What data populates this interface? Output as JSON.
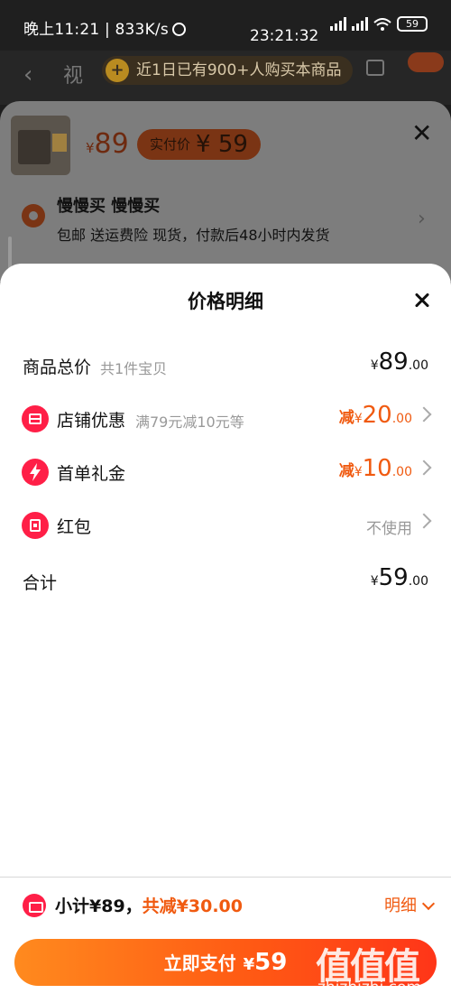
{
  "status_bar": {
    "left_text": "晚上11:21 | 833K/s",
    "time_center": "23:21:32",
    "battery": "59"
  },
  "background_page": {
    "title_fragment": "视",
    "promo_text": "近1日已有900+人购买本商品"
  },
  "sku_sheet": {
    "price_symbol": "¥",
    "price": "89",
    "pay_label": "实付价",
    "pay_price": "¥ 59",
    "name": "慢慢买 慢慢买",
    "shipping": "包邮 送运费险 现货，付款后48小时内发货"
  },
  "price_detail": {
    "title": "价格明细",
    "rows": [
      {
        "label": "商品总价",
        "sub": "共1件宝贝",
        "prefix": "",
        "yen": "¥",
        "int": "89",
        "dec": ".00"
      },
      {
        "label": "店铺优惠",
        "sub": "满79元减10元等",
        "prefix": "减",
        "yen": "¥",
        "int": "20",
        "dec": ".00"
      },
      {
        "label": "首单礼金",
        "sub": "",
        "prefix": "减",
        "yen": "¥",
        "int": "10",
        "dec": ".00"
      },
      {
        "label": "红包",
        "sub": "",
        "status": "不使用"
      },
      {
        "label": "合计",
        "sub": "",
        "prefix": "",
        "yen": "¥",
        "int": "59",
        "dec": ".00"
      }
    ]
  },
  "bottom_bar": {
    "subtotal_label": "小计¥89，",
    "saved_label": "共减¥30.00",
    "detail_link": "明细",
    "pay_button_label": "立即支付",
    "pay_button_yen": "¥",
    "pay_button_amount": "59"
  },
  "watermark": {
    "logo": "值值值",
    "url": "zhizhizhi.com"
  },
  "colors": {
    "accent_orange": "#f05a10",
    "icon_red": "#ff1f47",
    "button_gradient_start": "#ff8a1e",
    "button_gradient_end": "#ff3518"
  }
}
